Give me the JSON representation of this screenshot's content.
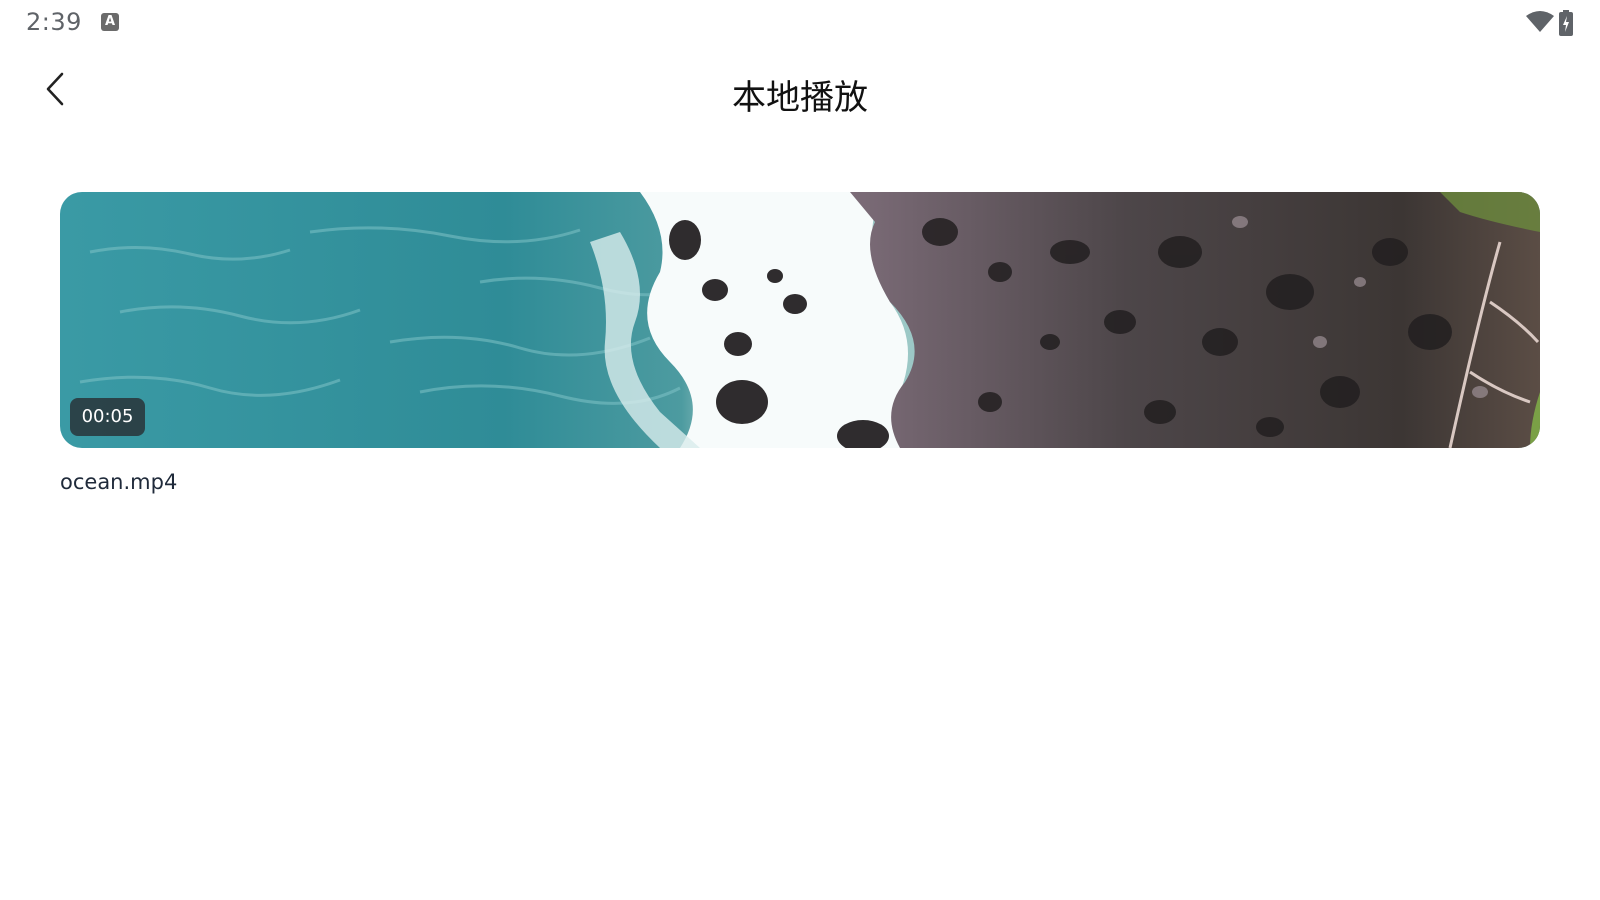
{
  "status_bar": {
    "time": "2:39",
    "notification_icon": "a-icon",
    "notification_letter": "A",
    "wifi_icon": "wifi-icon",
    "battery_icon": "battery-charging-icon"
  },
  "app_bar": {
    "back_icon": "back-arrow-icon",
    "title": "本地播放"
  },
  "videos": [
    {
      "duration": "00:05",
      "file_name": "ocean.mp4",
      "thumbnail": "ocean-coastline-aerial"
    }
  ],
  "colors": {
    "background": "#ffffff",
    "title_text": "#111111",
    "file_name_text": "#1f2a3a",
    "badge_bg": "#283034",
    "water": "#3f9aa3",
    "foam": "#ffffff",
    "rock": "#5d5459"
  }
}
